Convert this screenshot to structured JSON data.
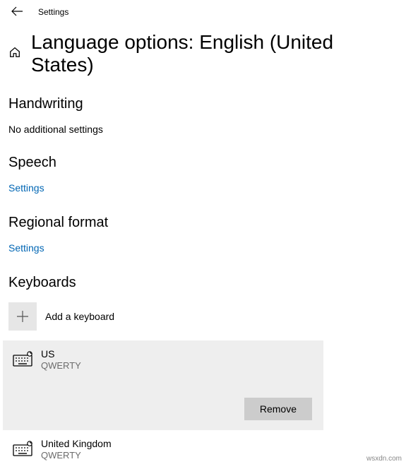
{
  "app": {
    "title": "Settings"
  },
  "page": {
    "title": "Language options: English (United States)"
  },
  "sections": {
    "handwriting": {
      "heading": "Handwriting",
      "text": "No additional settings"
    },
    "speech": {
      "heading": "Speech",
      "link": "Settings"
    },
    "regional": {
      "heading": "Regional format",
      "link": "Settings"
    },
    "keyboards": {
      "heading": "Keyboards",
      "add_label": "Add a keyboard",
      "items": [
        {
          "name": "US",
          "sub": "QWERTY",
          "selected": true
        },
        {
          "name": "United Kingdom",
          "sub": "QWERTY",
          "selected": false
        }
      ],
      "remove_label": "Remove"
    }
  },
  "watermark": "wsxdn.com"
}
